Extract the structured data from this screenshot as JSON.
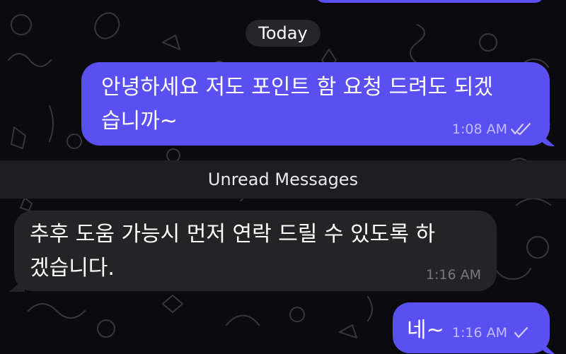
{
  "date_separator": "Today",
  "unread_separator": "Unread Messages",
  "messages": [
    {
      "direction": "outgoing",
      "text": "안녕하세요 저도 포인트 함 요청 드려도 되겠\n습니까~",
      "time": "1:08 AM",
      "status": "double-check"
    },
    {
      "direction": "incoming",
      "text": "추후 도움 가능시 먼저 연락 드릴 수 있도록 하\n겠습니다.",
      "time": "1:16 AM"
    },
    {
      "direction": "outgoing",
      "text": "네~",
      "time": "1:16 AM",
      "status": "single-check"
    }
  ],
  "colors": {
    "background": "#0b0b0d",
    "outgoing_bubble": "#5a4ff1",
    "incoming_bubble": "#242427",
    "text": "#ffffff"
  }
}
